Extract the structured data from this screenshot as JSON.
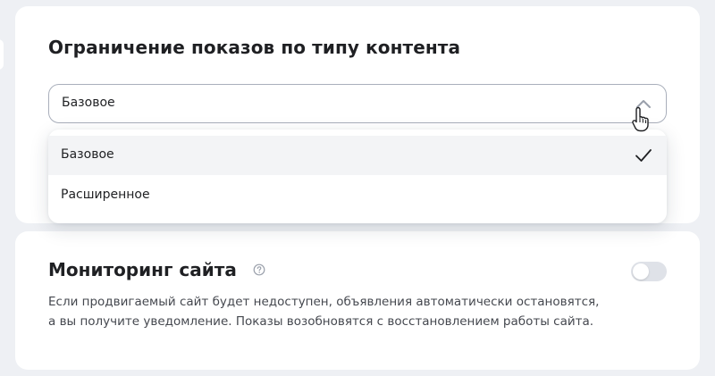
{
  "content_limit": {
    "title": "Ограничение показов по типу контента",
    "selected_value": "Базовое",
    "options": [
      {
        "label": "Базовое",
        "selected": true
      },
      {
        "label": "Расширенное",
        "selected": false
      }
    ]
  },
  "site_monitoring": {
    "title": "Мониторинг сайта",
    "description_line1": "Если продвигаемый сайт будет недоступен, объявления автоматически остановятся,",
    "description_line2": "а вы получите уведомление. Показы возобновятся с восстановлением работы сайта.",
    "toggle_on": false
  },
  "icons": {
    "chevron": "chevron-up-icon",
    "check": "checkmark-icon",
    "help": "question-circle-icon",
    "cursor": "hand-pointer-icon"
  },
  "colors": {
    "background": "#eef0f4",
    "card": "#ffffff",
    "text": "#1f2023",
    "muted_text": "#45484f",
    "border": "#a9afbb",
    "hover_row": "#f3f4f6",
    "toggle_off": "#dfe2e8"
  }
}
